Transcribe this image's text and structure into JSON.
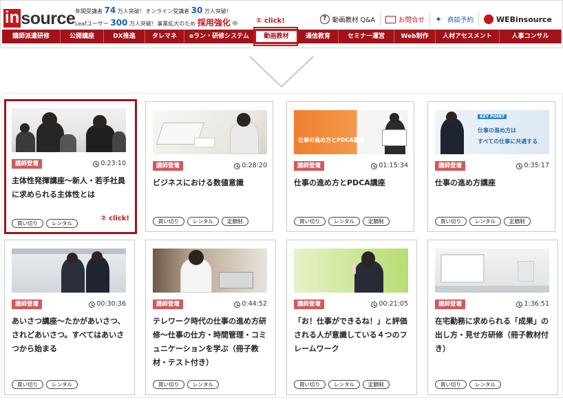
{
  "header": {
    "logo_in": "in",
    "logo_rest": "source",
    "info_line1_a": "年間受講者",
    "info_line1_b": "74",
    "info_line1_c": "万人突破!",
    "info_line1_d": "オンライン受講者",
    "info_line1_e": "30",
    "info_line1_f": "万人突破!",
    "info_line2_a": "Leafユーザー",
    "info_line2_b": "300",
    "info_line2_c": "万人突破!",
    "info_line2_d": "事業拡大のため",
    "info_line2_e": "採用強化",
    "info_line2_f": "中",
    "util_qa": "動画教材 Q&A",
    "util_contact": "お問合せ",
    "util_meeting": "商談予約",
    "util_web": "WEBinsource",
    "click1": "① click!"
  },
  "nav": [
    {
      "label": "講師派遣研修"
    },
    {
      "label": "公開講座"
    },
    {
      "label": "DX推進"
    },
    {
      "label": "タレマネ"
    },
    {
      "label": "eラン・研修システム"
    },
    {
      "label": "動画教材"
    },
    {
      "label": "通信教育"
    },
    {
      "label": "セミナー運営"
    },
    {
      "label": "Web制作"
    },
    {
      "label": "人材アセスメント"
    },
    {
      "label": "人事コンサル"
    }
  ],
  "cards": [
    {
      "badge": "講師登壇",
      "duration": "0:23:10",
      "title": "主体性発揮講座〜新人・若手社員に求められる主体性とは",
      "tags": [
        "買い切り",
        "レンタル"
      ],
      "click": "② click!"
    },
    {
      "badge": "講師登壇",
      "duration": "0:28:20",
      "title": "ビジネスにおける数値意識",
      "tags": [
        "買い切り",
        "レンタル",
        "定額制"
      ]
    },
    {
      "badge": "講師登壇",
      "duration": "01:15:34",
      "title": "仕事の進め方とPDCA講座",
      "tags": [
        "買い切り",
        "レンタル",
        "定額制"
      ],
      "thumb_text": "仕事の進め方とPDCA講座"
    },
    {
      "badge": "講師登壇",
      "duration": "0:35:17",
      "title": "仕事の進め方講座",
      "tags": [
        "買い切り",
        "レンタル",
        "定額制"
      ],
      "thumb_text1": "KEY POINT",
      "thumb_text2": "仕事の進め方は",
      "thumb_text3": "すべての仕事に共通する"
    },
    {
      "badge": "講師登壇",
      "duration": "00:30:36",
      "title": "あいさつ講座〜たかがあいさつ、されどあいさつ。すべてはあいさつから始まる",
      "tags": [
        "買い切り",
        "レンタル"
      ]
    },
    {
      "badge": "講師登壇",
      "duration": "0:44:52",
      "title": "テレワーク時代の仕事の進め方研修〜仕事の仕方・時間管理・コミュニケーションを学ぶ（冊子教材・テスト付き）",
      "tags": [
        "買い切り",
        "レンタル"
      ]
    },
    {
      "badge": "講師登壇",
      "duration": "00:21:05",
      "title": "「お！仕事ができるね！」と評価される人が意識している４つのフレームワーク",
      "tags": [
        "買い切り",
        "レンタル",
        "定額制"
      ]
    },
    {
      "badge": "講師登壇",
      "duration": "1:36:51",
      "title": "在宅勤務に求められる「成果」の出し方・見せ方研修（冊子教材付き）",
      "tags": [
        "買い切り",
        "レンタル"
      ]
    }
  ],
  "colors": {
    "brand": "#a11219",
    "badge": "#cf5a5d",
    "accent_blue": "#1d5fa8"
  }
}
